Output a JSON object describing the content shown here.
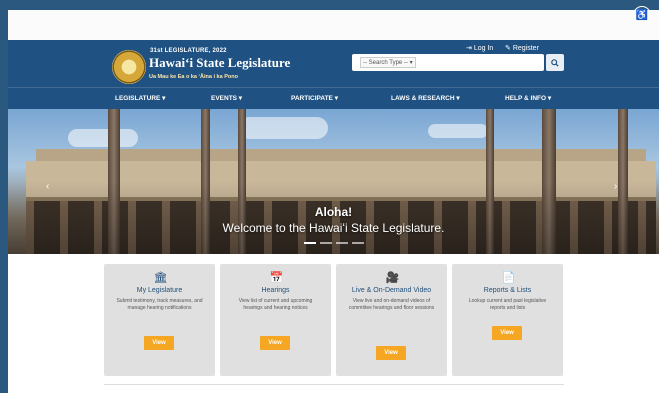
{
  "header": {
    "legislature_small": "31st LEGISLATURE, 2022",
    "site_title": "Hawaiʻi State Legislature",
    "motto": "Ua Mau ke Ea o ka ʻĀina i ka Pono",
    "login_label": "Log In",
    "register_label": "Register",
    "search_type_label": "-- Search Type -- ▾",
    "search_placeholder": "",
    "accent": "#1f5182"
  },
  "nav": {
    "items": [
      {
        "label": "LEGISLATURE ▾"
      },
      {
        "label": "EVENTS ▾"
      },
      {
        "label": "PARTICIPATE ▾"
      },
      {
        "label": "LAWS & RESEARCH ▾"
      },
      {
        "label": "HELP & INFO ▾"
      }
    ]
  },
  "hero": {
    "title": "Aloha!",
    "subtitle": "Welcome to the Hawaiʻi State Legislature."
  },
  "cards": [
    {
      "icon": "building-icon",
      "title": "My Legislature",
      "description": "Submit testimony, track measures, and manage hearing notifications",
      "button": "View"
    },
    {
      "icon": "calendar-icon",
      "title": "Hearings",
      "description": "View list of current and upcoming hearings and hearing notices",
      "button": "View"
    },
    {
      "icon": "video-icon",
      "title": "Live & On-Demand Video",
      "description": "View live and on-demand videos of committee hearings and floor sessions",
      "button": "View"
    },
    {
      "icon": "document-icon",
      "title": "Reports & Lists",
      "description": "Lookup current and past legislative reports and lists",
      "button": "View"
    }
  ]
}
